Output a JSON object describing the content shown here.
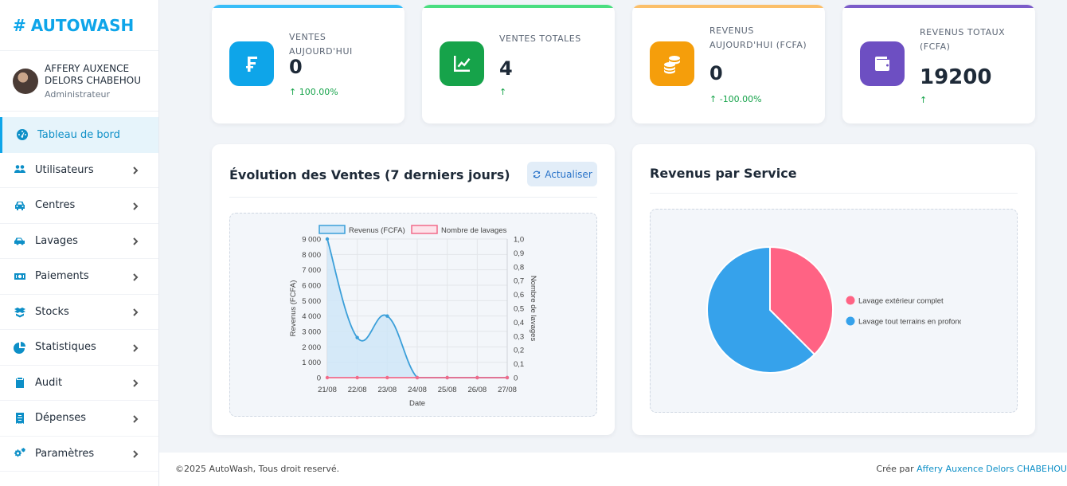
{
  "brand": {
    "hash": "#",
    "name": "AUTOWASH"
  },
  "user": {
    "name": "AFFERY AUXENCE DELORS CHABEHOU",
    "role": "Administrateur"
  },
  "nav": [
    {
      "label": "Tableau de bord",
      "icon": "dashboard-icon"
    },
    {
      "label": "Utilisateurs",
      "icon": "users-icon"
    },
    {
      "label": "Centres",
      "icon": "car-icon"
    },
    {
      "label": "Lavages",
      "icon": "car-wash-icon"
    },
    {
      "label": "Paiements",
      "icon": "money-icon"
    },
    {
      "label": "Stocks",
      "icon": "boxes-icon"
    },
    {
      "label": "Statistiques",
      "icon": "pie-chart-icon"
    },
    {
      "label": "Audit",
      "icon": "clipboard-check-icon"
    },
    {
      "label": "Dépenses",
      "icon": "receipt-icon"
    },
    {
      "label": "Paramètres",
      "icon": "cogs-icon"
    }
  ],
  "stats": [
    {
      "label": "VENTES AUJOURD'HUI",
      "value": "0",
      "trend": "100.00%",
      "color": "#0ea5e9",
      "icon": "franc-icon"
    },
    {
      "label": "VENTES TOTALES",
      "value": "4",
      "trend": "",
      "color": "#16a34a",
      "icon": "line-chart-icon"
    },
    {
      "label": "REVENUS AUJOURD'HUI (FCFA)",
      "value": "0",
      "trend": "-100.00%",
      "color": "#f59e0b",
      "icon": "coins-icon"
    },
    {
      "label": "REVENUS TOTAUX (FCFA)",
      "value": "19200",
      "trend": "",
      "color": "#6d4fc2",
      "icon": "wallet-icon"
    }
  ],
  "sales_chart": {
    "title": "Évolution des Ventes (7 derniers jours)",
    "refresh_label": "Actualiser"
  },
  "revenue_chart": {
    "title": "Revenus par Service"
  },
  "chart_data": [
    {
      "type": "line",
      "x": [
        "21/08",
        "22/08",
        "23/08",
        "24/08",
        "25/08",
        "26/08",
        "27/08"
      ],
      "series": [
        {
          "name": "Revenus (FCFA)",
          "values": [
            9000,
            2600,
            4000,
            0,
            0,
            0,
            0
          ],
          "color": "#3b9fd9",
          "fill": "#cfe6f7",
          "axis": "left"
        },
        {
          "name": "Nombre de lavages",
          "values": [
            0,
            0,
            0,
            0,
            0,
            0,
            0
          ],
          "color": "#f26b8a",
          "axis": "right"
        }
      ],
      "xlabel": "Date",
      "ylabel": "Revenus (FCFA)",
      "y2label": "Nombre de lavages",
      "ylim": [
        0,
        9000
      ],
      "yticks": [
        "0",
        "1 000",
        "2 000",
        "3 000",
        "4 000",
        "5 000",
        "6 000",
        "7 000",
        "8 000",
        "9 000"
      ],
      "y2lim": [
        0,
        1
      ],
      "y2ticks": [
        "0",
        "0,1",
        "0,2",
        "0,3",
        "0,4",
        "0,5",
        "0,6",
        "0,7",
        "0,8",
        "0,9",
        "1,0"
      ],
      "grid": true,
      "legend": "top"
    },
    {
      "type": "pie",
      "categories": [
        "Lavage extérieur complet",
        "Lavage tout terrains en profondeur"
      ],
      "values": [
        7200,
        12000
      ],
      "colors": [
        "#ff6384",
        "#36a2eb"
      ],
      "legend": "right"
    }
  ],
  "footer": {
    "copyright": "©2025 AutoWash, Tous droit reservé.",
    "credit_prefix": "Crée par ",
    "credit_name": "Affery Auxence Delors CHABEHOU"
  }
}
